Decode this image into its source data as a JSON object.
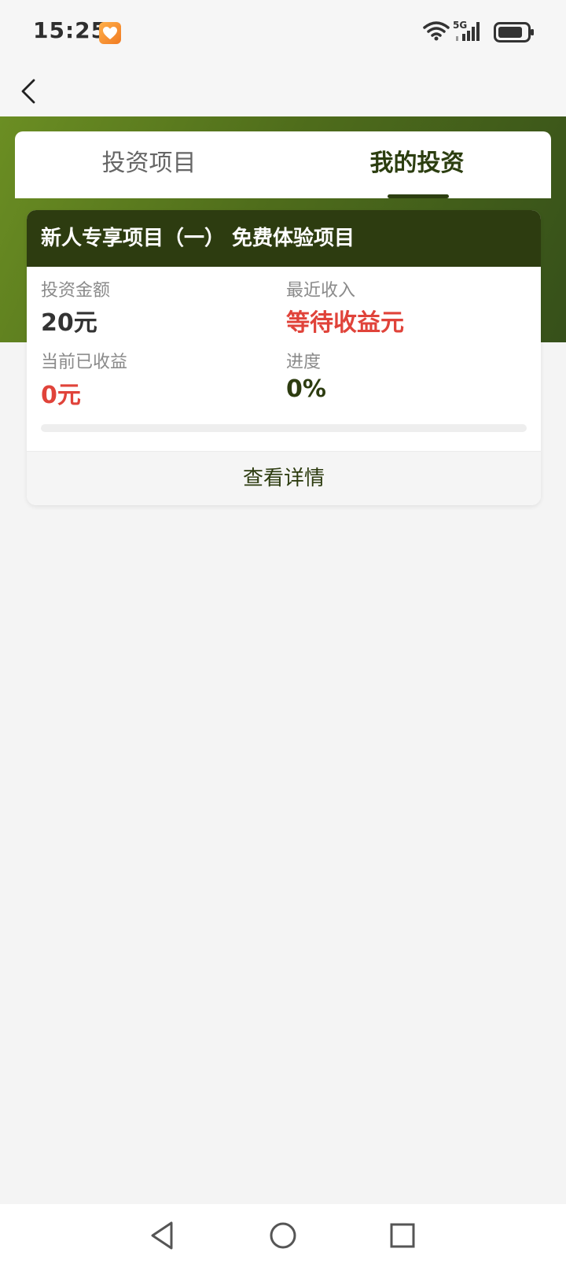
{
  "status_bar": {
    "time": "15:25",
    "network": "5G"
  },
  "tabs": [
    {
      "label": "投资项目",
      "active": false
    },
    {
      "label": "我的投资",
      "active": true
    }
  ],
  "investment": {
    "title": "新人专享项目（一） 免费体验项目",
    "amount_label": "投资金额",
    "amount_value": "20元",
    "recent_income_label": "最近收入",
    "recent_income_value": "等待收益元",
    "earned_label": "当前已收益",
    "earned_value": "0元",
    "progress_label": "进度",
    "progress_value": "0%",
    "progress_fraction": 0,
    "details_button": "查看详情"
  },
  "colors": {
    "brand_dark": "#2d3c10",
    "brand_green": "#6b8e23",
    "accent_red": "#e0433a"
  },
  "icons": [
    "back-arrow-icon",
    "wifi-icon",
    "signal-icon",
    "battery-icon",
    "nav-back-icon",
    "nav-home-icon",
    "nav-recent-icon"
  ]
}
